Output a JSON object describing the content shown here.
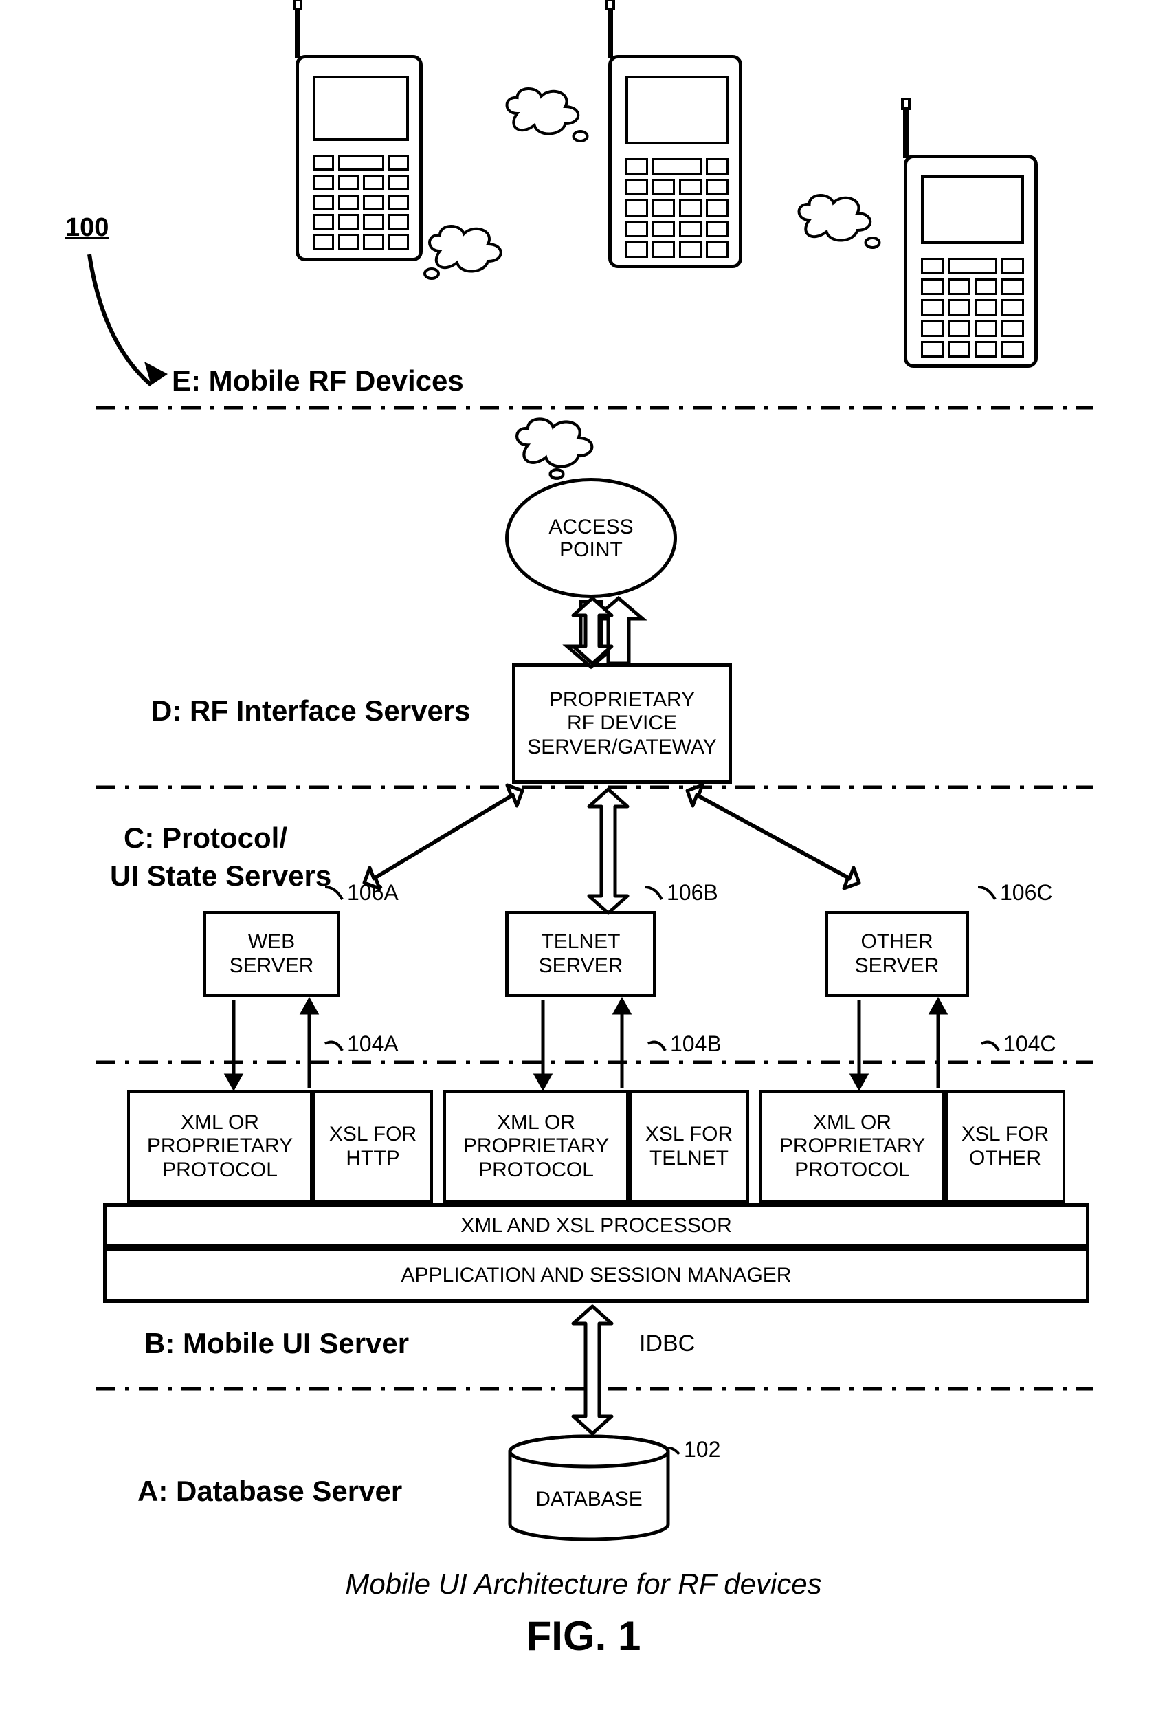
{
  "figure": {
    "reference": "100",
    "caption": "Mobile UI Architecture for RF devices",
    "label": "FIG. 1"
  },
  "layers": {
    "E": {
      "label": "E: Mobile RF Devices"
    },
    "D": {
      "label": "D: RF Interface Servers"
    },
    "C": {
      "label_line1": "C: Protocol/",
      "label_line2": "UI State Servers"
    },
    "B": {
      "label": "B: Mobile UI Server"
    },
    "A": {
      "label": "A: Database Server"
    }
  },
  "nodes": {
    "access_point": "ACCESS POINT",
    "rf_gateway": "PROPRIETARY RF DEVICE SERVER/GATEWAY",
    "servers": {
      "web": {
        "label": "WEB SERVER",
        "ref": "106A"
      },
      "telnet": {
        "label": "TELNET SERVER",
        "ref": "106B"
      },
      "other": {
        "label": "OTHER SERVER",
        "ref": "106C"
      }
    },
    "blocks": {
      "a": {
        "proto": "XML OR PROPRIETARY PROTOCOL",
        "xsl": "XSL FOR HTTP",
        "ref": "104A"
      },
      "b": {
        "proto": "XML OR PROPRIETARY PROTOCOL",
        "xsl": "XSL FOR TELNET",
        "ref": "104B"
      },
      "c": {
        "proto": "XML OR PROPRIETARY PROTOCOL",
        "xsl": "XSL FOR OTHER",
        "ref": "104C"
      }
    },
    "xml_processor": "XML AND XSL PROCESSOR",
    "app_manager": "APPLICATION AND SESSION MANAGER",
    "idbc": "IDBC",
    "database": {
      "label": "DATABASE",
      "ref": "102"
    }
  }
}
